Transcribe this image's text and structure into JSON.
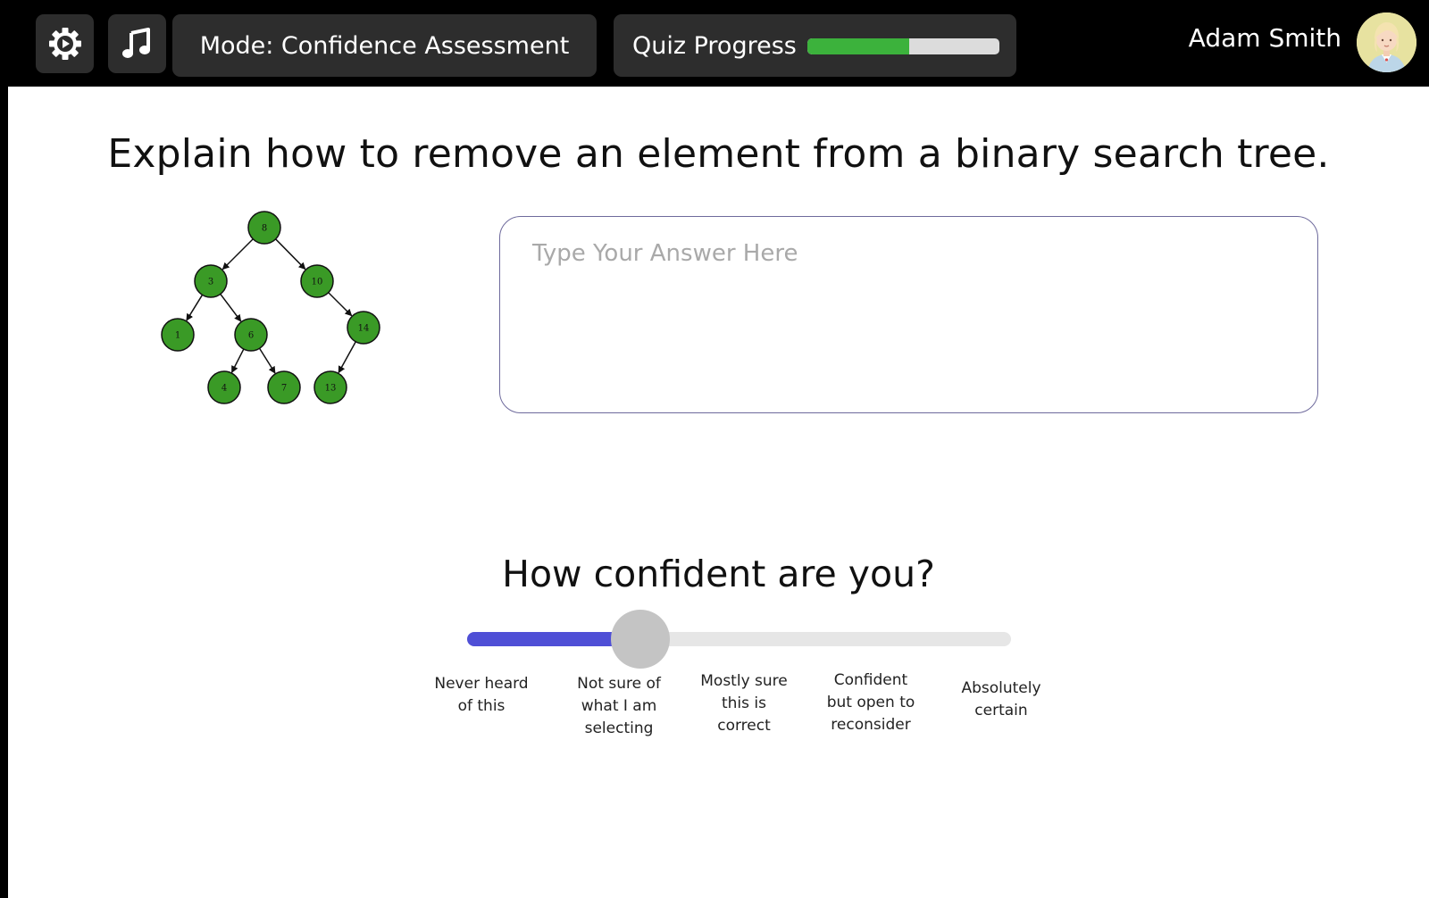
{
  "header": {
    "settings_icon": "gear-icon",
    "music_icon": "music-note-icon",
    "mode_label": "Mode: Confidence Assessment",
    "progress_label": "Quiz Progress",
    "progress_fraction": 0.53,
    "user_name": "Adam Smith"
  },
  "main": {
    "question": "Explain how to remove an element from a binary search tree.",
    "answer_placeholder": "Type Your Answer Here",
    "answer_value": ""
  },
  "tree": {
    "node_color": "#3a9a26",
    "nodes": [
      {
        "id": "8",
        "label": "8"
      },
      {
        "id": "3",
        "label": "3"
      },
      {
        "id": "10",
        "label": "10"
      },
      {
        "id": "1",
        "label": "1"
      },
      {
        "id": "6",
        "label": "6"
      },
      {
        "id": "14",
        "label": "14"
      },
      {
        "id": "4",
        "label": "4"
      },
      {
        "id": "7",
        "label": "7"
      },
      {
        "id": "13",
        "label": "13"
      }
    ],
    "edges": [
      [
        "8",
        "3"
      ],
      [
        "8",
        "10"
      ],
      [
        "3",
        "1"
      ],
      [
        "3",
        "6"
      ],
      [
        "10",
        "14"
      ],
      [
        "6",
        "4"
      ],
      [
        "6",
        "7"
      ],
      [
        "14",
        "13"
      ]
    ]
  },
  "confidence": {
    "title": "How confident are you?",
    "value_index": 1,
    "levels": [
      "Never heard of this",
      "Not sure of what I am selecting",
      "Mostly sure this is correct",
      "Confident but open to reconsider",
      "Absolutely certain"
    ],
    "fill_color": "#4f4fd6"
  }
}
